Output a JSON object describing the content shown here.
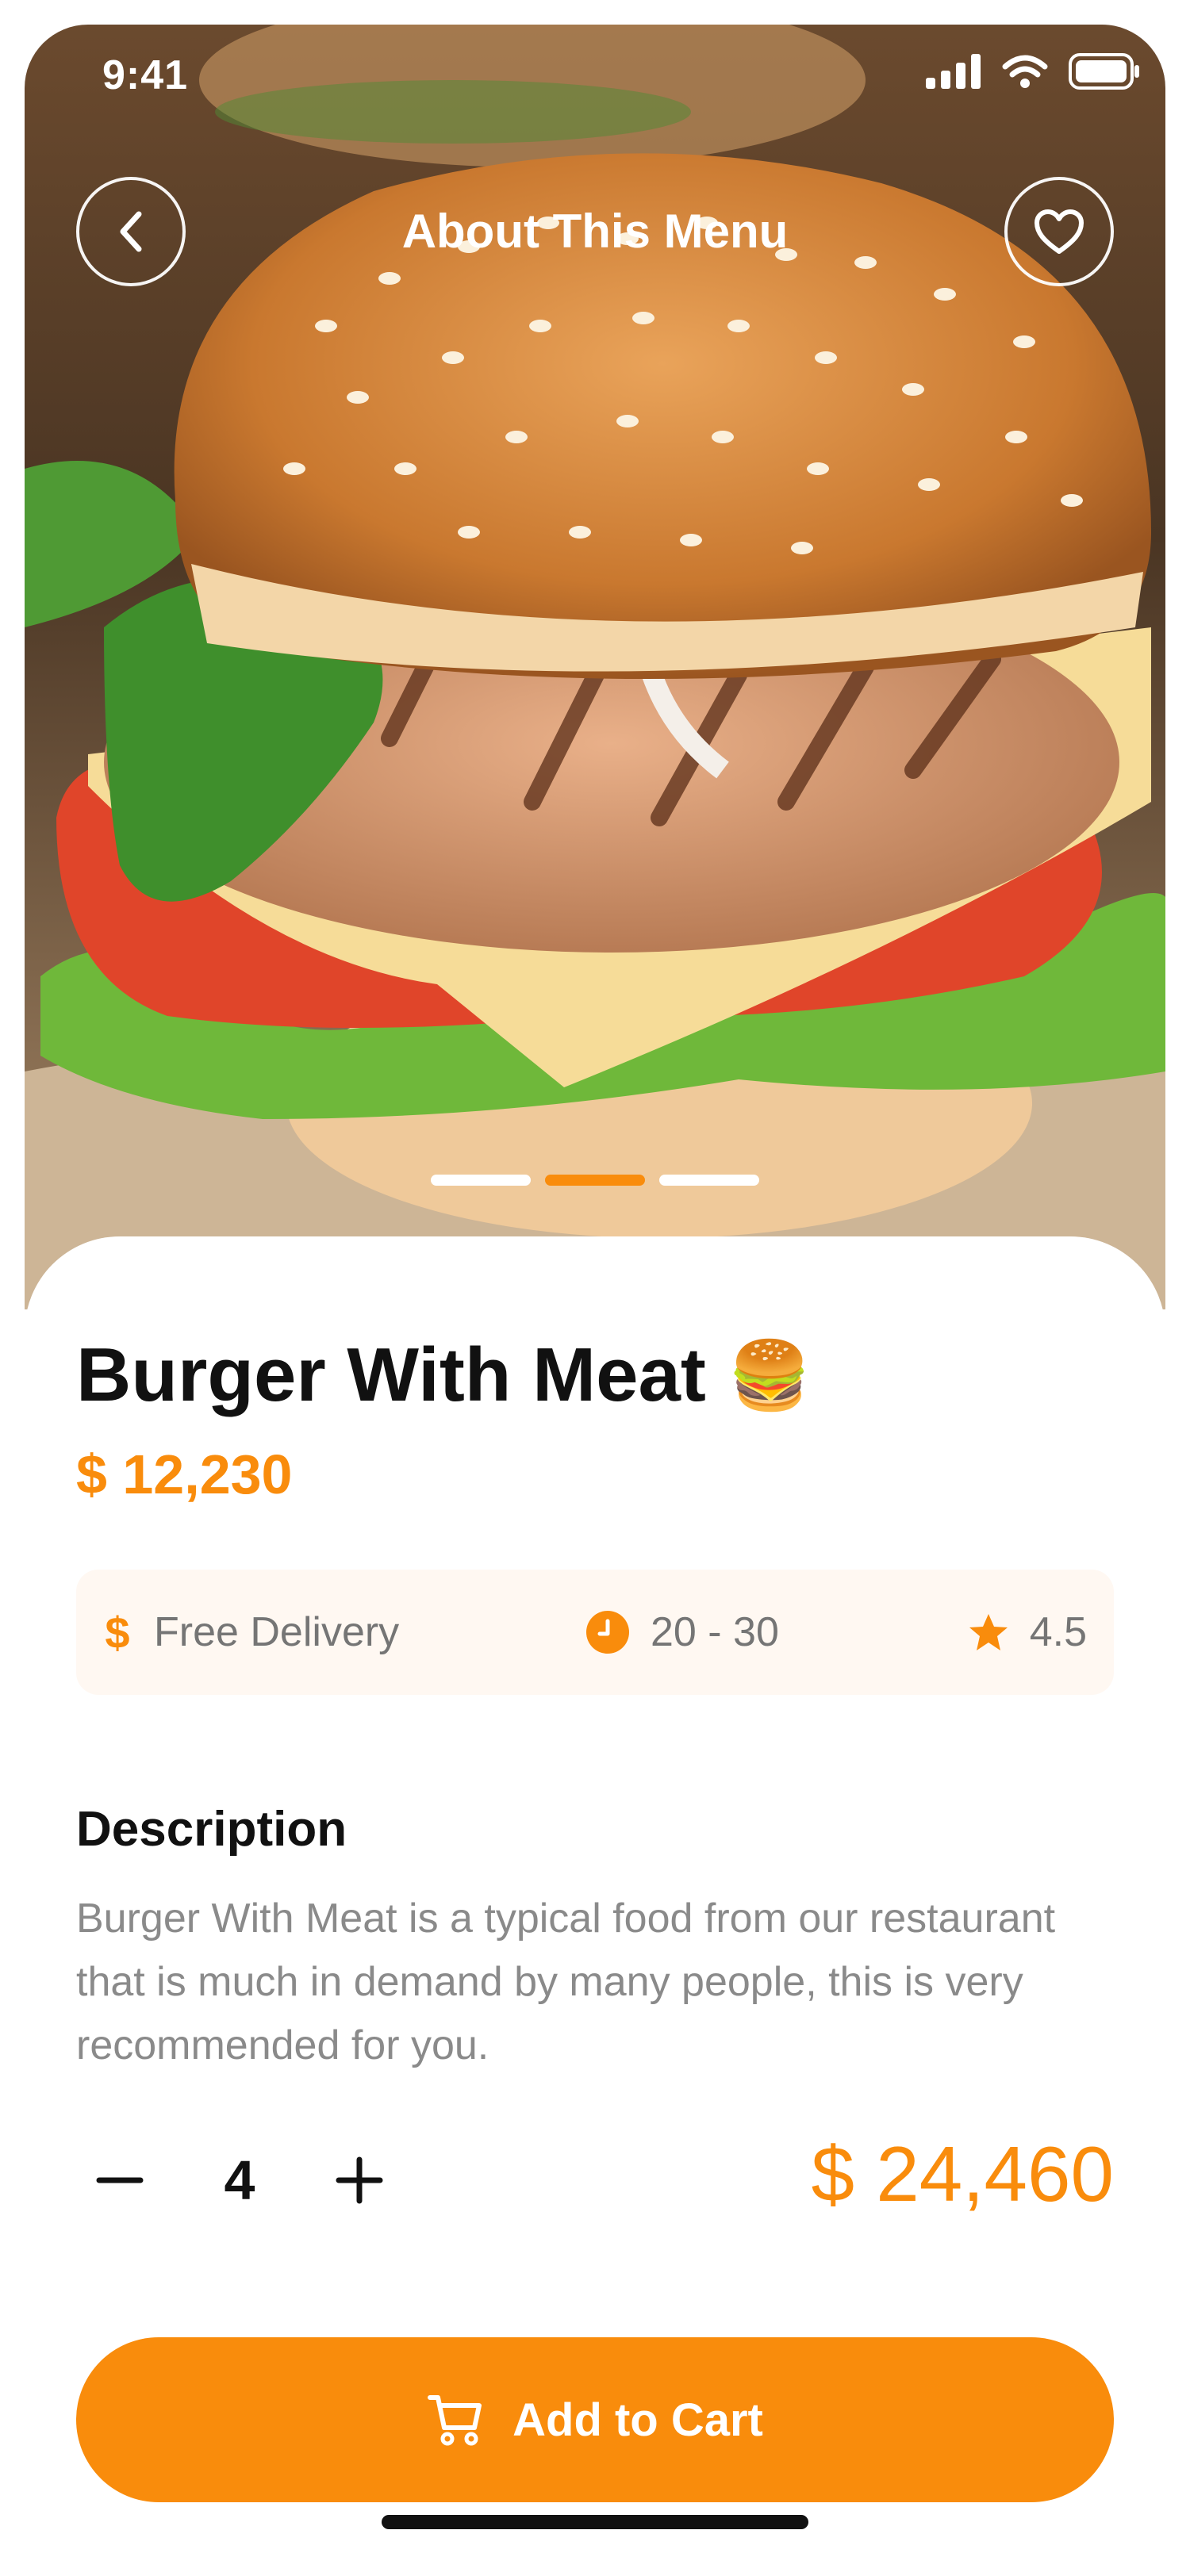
{
  "status_bar": {
    "time": "9:41"
  },
  "header": {
    "title": "About This Menu"
  },
  "carousel": {
    "slides": 3,
    "active_index": 1
  },
  "product": {
    "name": "Burger With Meat",
    "emoji": "🍔",
    "price": "$ 12,230"
  },
  "info": {
    "delivery": "Free Delivery",
    "time": "20 - 30",
    "rating": "4.5"
  },
  "description": {
    "heading": "Description",
    "text": "Burger With Meat is a typical food from our restaurant that is much in demand by many people, this is very recommended for you."
  },
  "order": {
    "quantity": "4",
    "total": "$ 24,460"
  },
  "cart_button": {
    "label": "Add to Cart"
  },
  "colors": {
    "accent": "#F98C0C",
    "text": "#111111",
    "muted": "#8A8A8A",
    "info_bg": "#FFF8F2"
  }
}
